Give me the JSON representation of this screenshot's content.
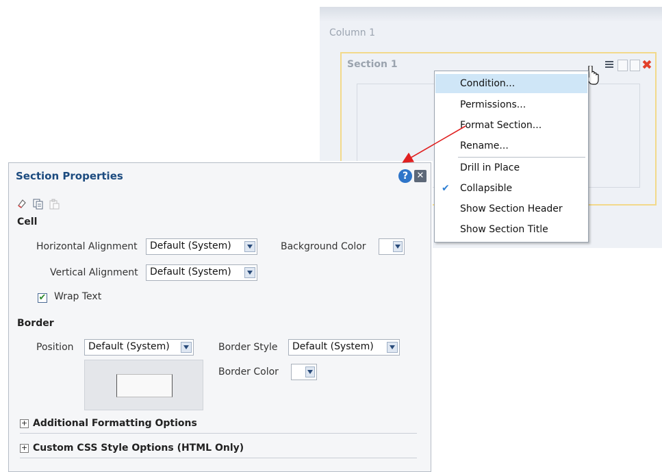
{
  "editor": {
    "column_label": "Column 1",
    "section_label": "Section 1",
    "toolbar_icons": [
      "section-menu-icon",
      "layout-icon",
      "split-icon",
      "delete-icon"
    ],
    "delete_glyph": "✖"
  },
  "context_menu": {
    "items": [
      {
        "label": "Condition...",
        "highlighted": true
      },
      {
        "label": "Permissions..."
      },
      {
        "label": "Format Section..."
      },
      {
        "label": "Rename..."
      },
      {
        "label": "Drill in Place"
      },
      {
        "label": "Collapsible",
        "checked": true
      },
      {
        "label": "Show Section Header"
      },
      {
        "label": "Show Section Title"
      }
    ],
    "check_glyph": "✔"
  },
  "dialog": {
    "title": "Section Properties",
    "help_glyph": "?",
    "close_glyph": "✕",
    "cell": {
      "heading": "Cell",
      "horizontal_alignment_label": "Horizontal Alignment",
      "horizontal_alignment_value": "Default (System)",
      "background_color_label": "Background Color",
      "vertical_alignment_label": "Vertical Alignment",
      "vertical_alignment_value": "Default (System)",
      "wrap_text_label": "Wrap Text",
      "wrap_text_checked": true,
      "check_glyph": "✔"
    },
    "border": {
      "heading": "Border",
      "position_label": "Position",
      "position_value": "Default (System)",
      "border_style_label": "Border Style",
      "border_style_value": "Default (System)",
      "border_color_label": "Border Color"
    },
    "expanders": [
      {
        "label": "Additional Formatting Options",
        "glyph": "+"
      },
      {
        "label": "Custom CSS Style Options (HTML Only)",
        "glyph": "+"
      }
    ]
  },
  "colors": {
    "title_blue": "#1c4b7f",
    "menu_highlight": "#cfe6f7",
    "annotation_arrow": "#e02020",
    "section_border": "#f2d98a"
  }
}
